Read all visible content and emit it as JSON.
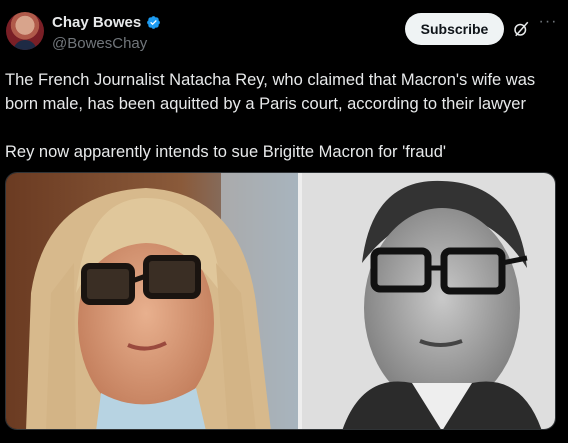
{
  "author": {
    "name": "Chay Bowes",
    "handle": "@BowesChay",
    "verified": true,
    "avatar_icon": "profile-avatar"
  },
  "actions": {
    "subscribe_label": "Subscribe",
    "grok_icon": "grok-icon",
    "more_icon": "more-options-icon"
  },
  "tweet": {
    "text": "The French Journalist Natacha Rey, who claimed that Macron's wife was born male, has been aquitted by a Paris court, according to their lawyer\n\nRey now apparently intends to sue Brigitte Macron for 'fraud'"
  },
  "media": {
    "images": [
      {
        "description_icon": "photo-woman-glasses"
      },
      {
        "description_icon": "photo-man-glasses-bw"
      }
    ]
  },
  "colors": {
    "background": "#000000",
    "text": "#e7e9ea",
    "muted": "#71767b",
    "verified": "#1d9bf0",
    "button_bg": "#eff3f4"
  }
}
